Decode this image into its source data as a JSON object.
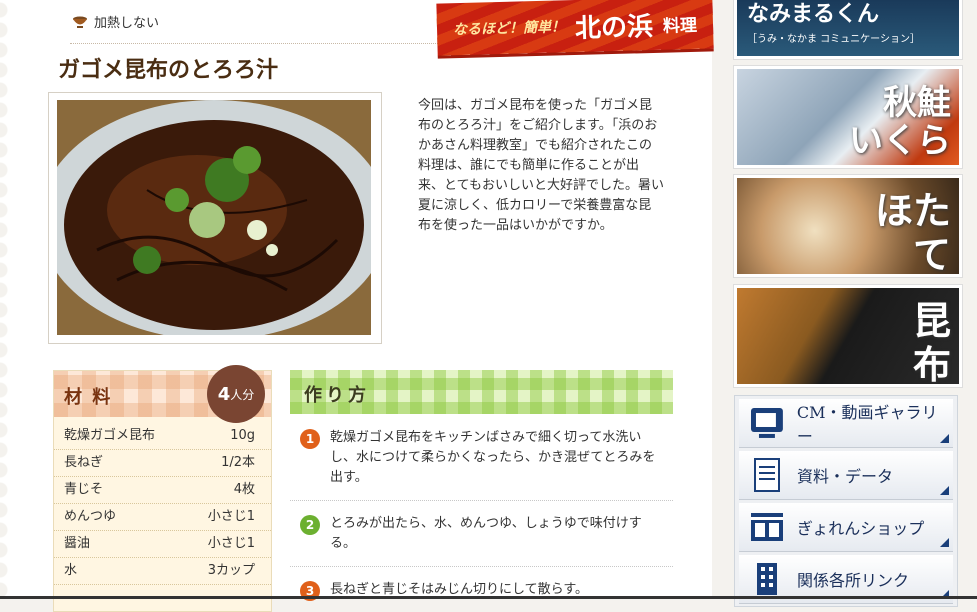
{
  "header": {
    "heat_label": "加熱しない",
    "banner_small": "なるほど！簡単！",
    "banner_big": "北の浜",
    "banner_suffix": "料理"
  },
  "recipe": {
    "title": "ガゴメ昆布のとろろ汁",
    "intro": "今回は、ガゴメ昆布を使った「ガゴメ昆布のとろろ汁」をご紹介します。「浜のおかあさん料理教室」でも紹介されたこの料理は、誰にでも簡単に作ることが出来、とてもおいしいと大好評でした。暑い夏に涼しく、低カロリーで栄養豊富な昆布を使った一品はいかがですか。"
  },
  "ingredients": {
    "title": "材 料",
    "serves_num": "4",
    "serves_unit": "人分",
    "items": [
      {
        "name": "乾燥ガゴメ昆布",
        "qty": "10g"
      },
      {
        "name": "長ねぎ",
        "qty": "1/2本"
      },
      {
        "name": "青じそ",
        "qty": "4枚"
      },
      {
        "name": "めんつゆ",
        "qty": "小さじ1"
      },
      {
        "name": "醤油",
        "qty": "小さじ1"
      },
      {
        "name": "水",
        "qty": "3カップ"
      }
    ]
  },
  "steps": {
    "title": "作り方",
    "items": [
      {
        "num": "1",
        "text": "乾燥ガゴメ昆布をキッチンばさみで細く切って水洗いし、水につけて柔らかくなったら、かき混ぜてとろみを出す。"
      },
      {
        "num": "2",
        "text": "とろみが出たら、水、めんつゆ、しょうゆで味付けする。"
      },
      {
        "num": "3",
        "text": "長ねぎと青じそはみじん切りにして散らす。"
      }
    ]
  },
  "sidebar": {
    "top_title": "なみまるくん",
    "top_sub": "［うみ・なかま コミュニケーション］",
    "tiles": [
      {
        "label_1": "秋鮭",
        "label_2": "いくら"
      },
      {
        "label_1": "ほた",
        "label_2": "て"
      },
      {
        "label_1": "昆",
        "label_2": "布"
      }
    ],
    "nav": [
      {
        "label": "CM・動画ギャラリー",
        "icon": "tv-icon"
      },
      {
        "label": "資料・データ",
        "icon": "document-icon"
      },
      {
        "label": "ぎょれんショップ",
        "icon": "shop-icon"
      },
      {
        "label": "関係各所リンク",
        "icon": "building-icon"
      }
    ]
  },
  "colors": {
    "accent": "#c82010",
    "step1": "#e0601a",
    "step2": "#6cb030",
    "step3": "#e0601a"
  }
}
